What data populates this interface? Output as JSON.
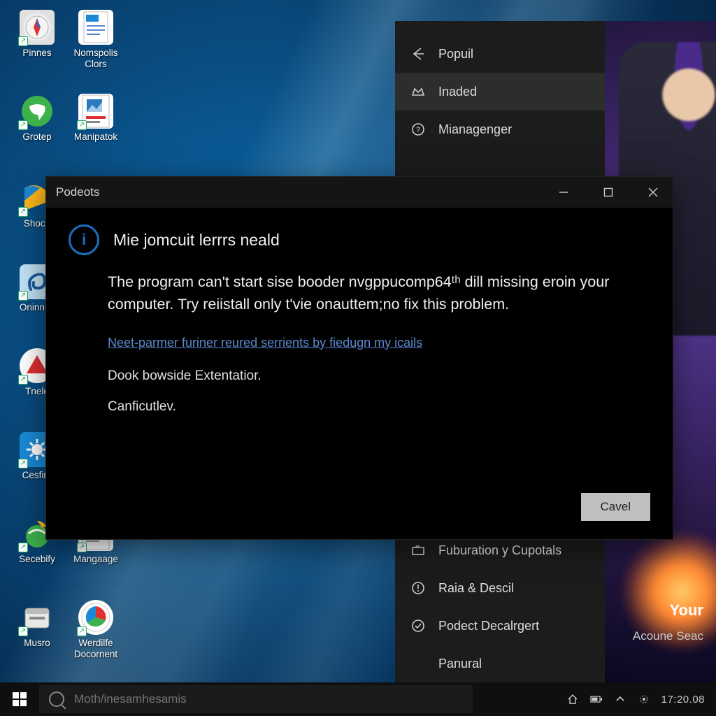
{
  "desktop_icons": [
    {
      "id": "pinnes",
      "label": "Pinnes"
    },
    {
      "id": "nomspolis-clors",
      "label": "Nomspolis Clors"
    },
    {
      "id": "grotep",
      "label": "Grotep"
    },
    {
      "id": "manipatok",
      "label": "Manipatok"
    },
    {
      "id": "shoce",
      "label": "Shoce"
    },
    {
      "id": "oninnes",
      "label": "Oninnes"
    },
    {
      "id": "tnele",
      "label": "Tnele"
    },
    {
      "id": "cesfira",
      "label": "Cesfira"
    },
    {
      "id": "secebify",
      "label": "Secebify"
    },
    {
      "id": "mangaage",
      "label": "Mangaage"
    },
    {
      "id": "musro",
      "label": "Musro"
    },
    {
      "id": "werdilfe-document",
      "label": "Werdilfe Docornent"
    }
  ],
  "bg_app": {
    "menu": [
      {
        "icon": "arrow-left",
        "label": "Popuil"
      },
      {
        "icon": "crown",
        "label": "Inaded",
        "selected": true
      },
      {
        "icon": "question",
        "label": "Mianagenger"
      }
    ],
    "lower_menu": [
      {
        "icon": "folder",
        "label": "Fuburation y Cupotals"
      },
      {
        "icon": "alert",
        "label": "Raia & Descil"
      },
      {
        "icon": "check",
        "label": "Podect Decalrgert"
      },
      {
        "icon": "blank",
        "label": "Panural"
      }
    ],
    "hero": {
      "title": "Your",
      "subtitle": "Acoune Seac"
    }
  },
  "dialog": {
    "window_title": "Podeots",
    "heading": "Mie jomcuit lerrrs neald",
    "message": "The program can't start sise booder nvgppucomp64ᵗʰ dill missing eroin your computer. Try reiistall only t'vie onauttem;no fix this problem.",
    "link_text": "Neet-parmer furiner reured serrients by fiedugn my icails",
    "line1": "Dook bowside Extentatior.",
    "line2": "Canficutlev.",
    "button_label": "Cavel"
  },
  "taskbar": {
    "search_placeholder": "Moth/inesamhesamis",
    "clock": "17:20.08"
  }
}
